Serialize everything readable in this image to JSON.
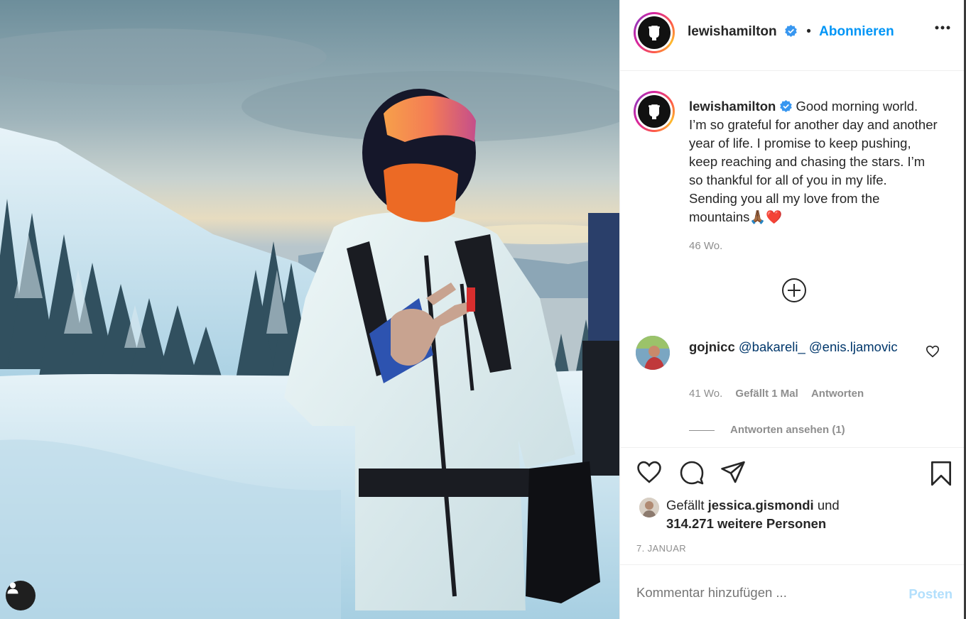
{
  "post": {
    "username": "lewishamilton",
    "follow_label": "Abonnieren",
    "dot": "•",
    "caption": "Good morning world. I’m so grateful for another day and another year of life. I promise to keep pushing, keep reaching and chasing the stars. I’m so thankful for all of you in my life. Sending you all my love from the mountains",
    "caption_emoji": "🙏🏾❤️",
    "caption_time": "46 Wo."
  },
  "comment": {
    "username": "gojnicc",
    "mention1": "@bakareli_",
    "mention2": "@enis.ljamovic",
    "time": "41 Wo.",
    "likes": "Gefällt 1 Mal",
    "reply": "Antworten",
    "view_replies": "Antworten ansehen (1)"
  },
  "likes": {
    "prefix": "Gefällt",
    "user": "jessica.gismondi",
    "and": "und",
    "others": "314.271 weitere Personen"
  },
  "date": "7. JANUAR",
  "add_comment": {
    "placeholder": "Kommentar hinzufügen ...",
    "post_label": "Posten"
  },
  "colors": {
    "link": "#0095f6",
    "muted": "#8e8e8e",
    "post_disabled": "#b2dffc"
  },
  "icons": [
    "fist-icon",
    "verified-icon",
    "more-icon",
    "plus-circle-icon",
    "heart-icon",
    "comment-icon",
    "share-icon",
    "bookmark-icon",
    "user-icon"
  ]
}
